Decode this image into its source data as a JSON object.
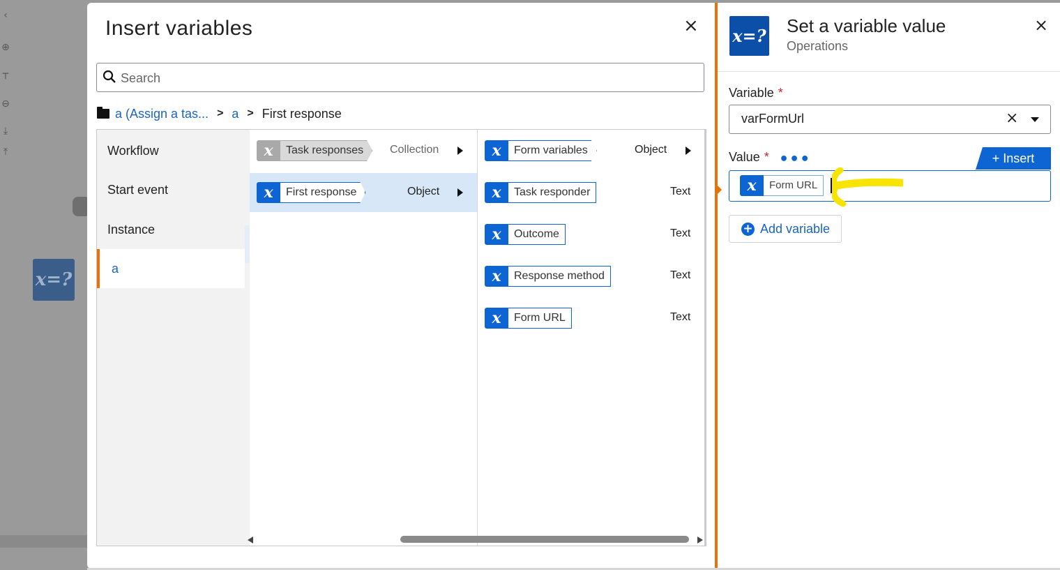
{
  "dialog": {
    "title": "Insert variables",
    "close_icon": "×",
    "search_placeholder": "Search",
    "breadcrumb": {
      "root": "a (Assign a tas...",
      "mid": "a",
      "current": "First response"
    }
  },
  "categories": [
    {
      "label": "Workflow"
    },
    {
      "label": "Start event"
    },
    {
      "label": "Instance"
    },
    {
      "label": "a"
    }
  ],
  "column2": [
    {
      "label": "Task responses",
      "type": "Collection"
    },
    {
      "label": "First response",
      "type": "Object"
    }
  ],
  "column3": [
    {
      "label": "Form variables",
      "type": "Object"
    },
    {
      "label": "Task responder",
      "type": "Text"
    },
    {
      "label": "Outcome",
      "type": "Text"
    },
    {
      "label": "Response method",
      "type": "Text"
    },
    {
      "label": "Form URL",
      "type": "Text"
    }
  ],
  "panel": {
    "logo_text": "x=?",
    "title": "Set a variable value",
    "subtitle": "Operations",
    "close_icon": "×",
    "variable_label": "Variable",
    "variable_value": "varFormUrl",
    "clear_icon": "×",
    "value_label": "Value",
    "required_mark": "*",
    "more_icon": "•••",
    "insert_label": "Insert",
    "insert_plus": "+",
    "value_token": "Form URL",
    "add_variable_label": "Add variable",
    "add_plus": "+"
  },
  "var_glyph": "x",
  "canvas": {
    "node_text": "x=?"
  },
  "colors": {
    "accent_blue": "#0d64d3",
    "accent_orange": "#e8710a",
    "highlight_yellow": "#f7e400"
  }
}
